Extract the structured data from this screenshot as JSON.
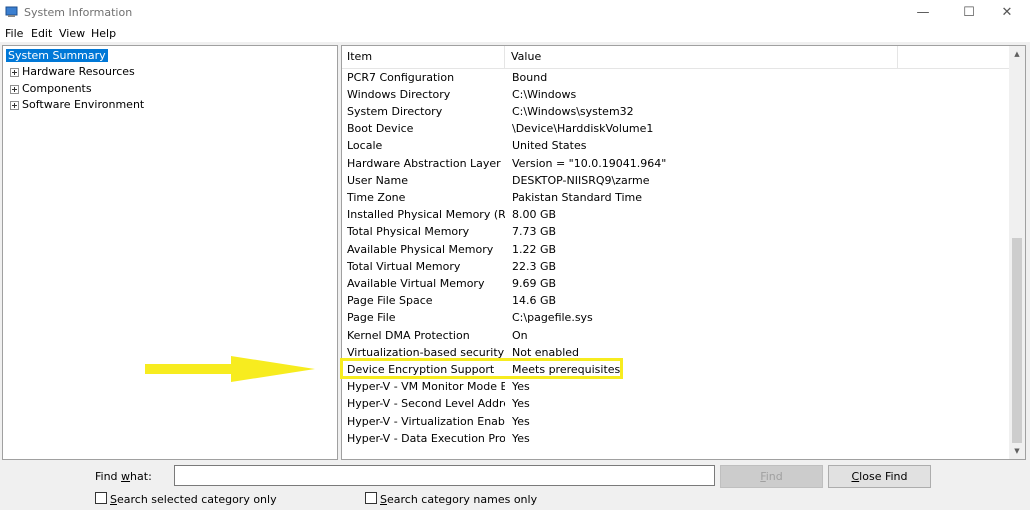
{
  "window": {
    "title": "System Information",
    "minimize_glyph": "—",
    "maximize_glyph": "☐",
    "close_glyph": "✕"
  },
  "menu": [
    {
      "label": "File"
    },
    {
      "label": "Edit"
    },
    {
      "label": "View"
    },
    {
      "label": "Help"
    }
  ],
  "tree": {
    "items": [
      {
        "label": "System Summary",
        "selected": true
      },
      {
        "label": "Hardware Resources"
      },
      {
        "label": "Components"
      },
      {
        "label": "Software Environment"
      }
    ]
  },
  "list": {
    "columns": {
      "item": "Item",
      "value": "Value"
    },
    "rows": [
      {
        "item": "PCR7 Configuration",
        "value": "Bound"
      },
      {
        "item": "Windows Directory",
        "value": "C:\\Windows"
      },
      {
        "item": "System Directory",
        "value": "C:\\Windows\\system32"
      },
      {
        "item": "Boot Device",
        "value": "\\Device\\HarddiskVolume1"
      },
      {
        "item": "Locale",
        "value": "United States"
      },
      {
        "item": "Hardware Abstraction Layer",
        "value": "Version = \"10.0.19041.964\""
      },
      {
        "item": "User Name",
        "value": "DESKTOP-NIISRQ9\\zarme"
      },
      {
        "item": "Time Zone",
        "value": "Pakistan Standard Time"
      },
      {
        "item": "Installed Physical Memory (RAM)",
        "value": "8.00 GB"
      },
      {
        "item": "Total Physical Memory",
        "value": "7.73 GB"
      },
      {
        "item": "Available Physical Memory",
        "value": "1.22 GB"
      },
      {
        "item": "Total Virtual Memory",
        "value": "22.3 GB"
      },
      {
        "item": "Available Virtual Memory",
        "value": "9.69 GB"
      },
      {
        "item": "Page File Space",
        "value": "14.6 GB"
      },
      {
        "item": "Page File",
        "value": "C:\\pagefile.sys"
      },
      {
        "item": "Kernel DMA Protection",
        "value": "On"
      },
      {
        "item": "Virtualization-based security",
        "value": "Not enabled"
      },
      {
        "item": "Device Encryption Support",
        "value": "Meets prerequisites",
        "highlighted": true
      },
      {
        "item": "Hyper-V - VM Monitor Mode E...",
        "value": "Yes"
      },
      {
        "item": "Hyper-V - Second Level Addres...",
        "value": "Yes"
      },
      {
        "item": "Hyper-V - Virtualization Enable...",
        "value": "Yes"
      },
      {
        "item": "Hyper-V - Data Execution Prote...",
        "value": "Yes"
      }
    ]
  },
  "find": {
    "label_pre": "Find ",
    "label_underlined": "w",
    "label_post": "hat:",
    "value": "",
    "find_button": {
      "underlined": "F",
      "rest": "ind"
    },
    "close_find_button": {
      "underlined": "C",
      "rest": "lose Find"
    },
    "checkbox_selected_category": {
      "underlined": "S",
      "rest": "earch selected category only",
      "checked": false
    },
    "checkbox_category_names": {
      "underlined": "S",
      "rest": "earch category names only",
      "checked": false
    }
  },
  "colors": {
    "selection": "#0078d7",
    "highlight_annotation": "#f7ec1f"
  }
}
